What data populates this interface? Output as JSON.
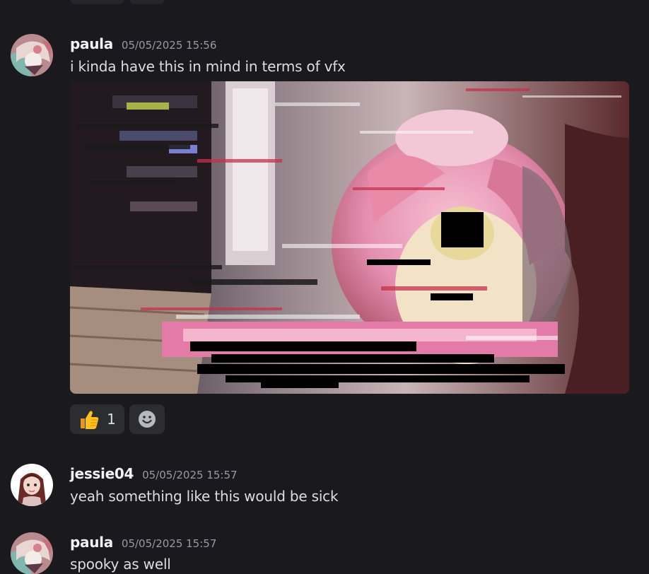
{
  "messages": [
    {
      "username": "paula",
      "timestamp": "05/05/2025 15:56",
      "text": "i kinda have this in mind in terms of vfx",
      "avatar": "paula-avatar",
      "attachment": "glitch-anime-image",
      "reactions": [
        {
          "icon": "thumbs-up-icon",
          "count": "1"
        },
        {
          "icon": "add-reaction-icon"
        }
      ]
    },
    {
      "username": "jessie04",
      "timestamp": "05/05/2025 15:57",
      "text": "yeah something like this would be sick",
      "avatar": "jessie-avatar"
    },
    {
      "username": "paula",
      "timestamp": "05/05/2025 15:57",
      "text": "spooky as well",
      "avatar": "paula-avatar"
    }
  ],
  "colors": {
    "background": "#1a1a1e",
    "username": "#f2f3f5",
    "timestamp": "#949ba4",
    "text": "#dbdee1",
    "reaction_bg": "#2b2d31"
  }
}
